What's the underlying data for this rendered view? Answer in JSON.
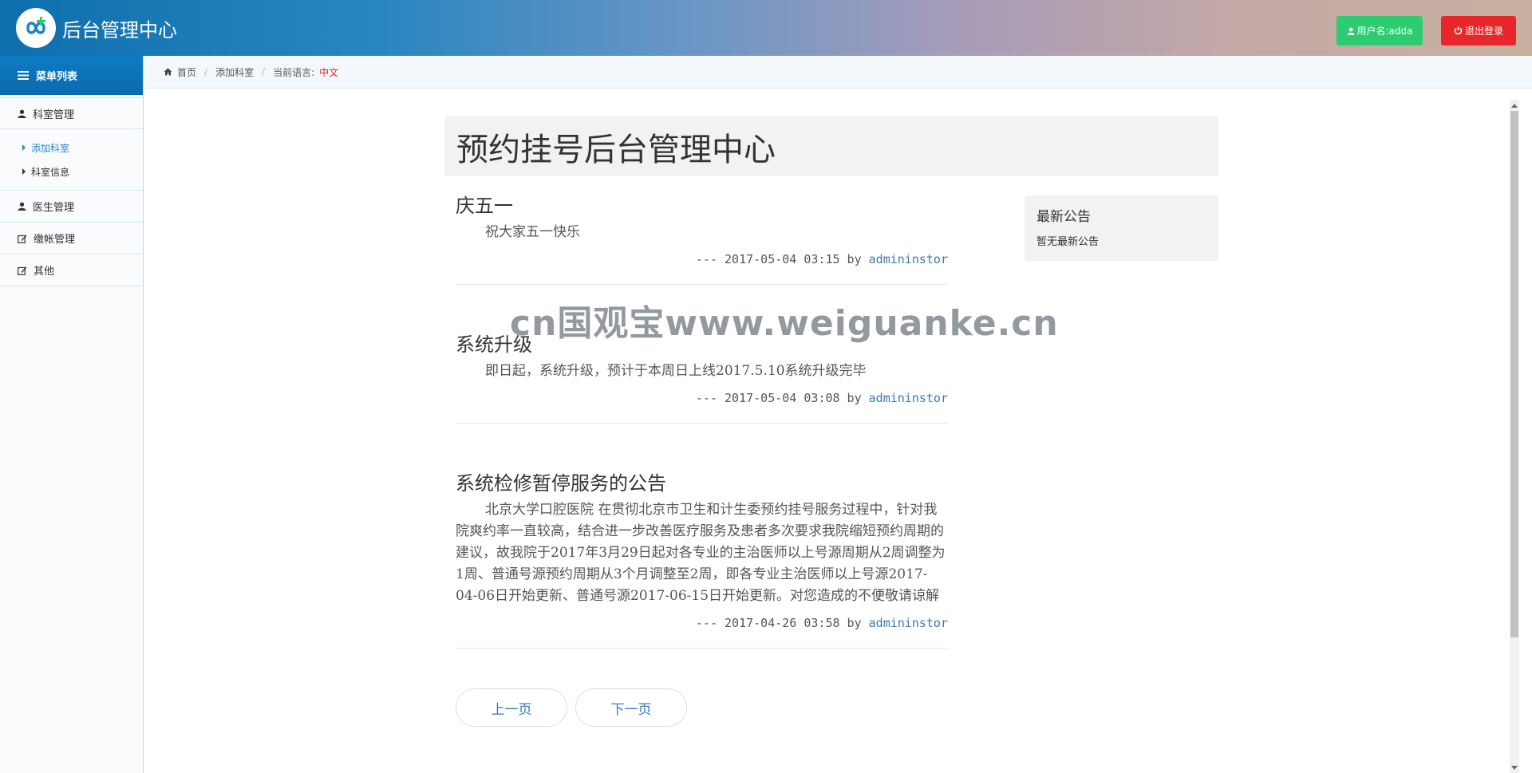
{
  "header": {
    "brand": "后台管理中心",
    "user_label": "用户名:adda",
    "logout_label": "退出登录",
    "accent_colors": {
      "user": "#2ecc71",
      "logout": "#e8272b"
    }
  },
  "sidebar": {
    "menu_title": "菜单列表",
    "groups": [
      {
        "label": "科室管理",
        "icon": "user-icon",
        "items": [
          {
            "label": "添加科室",
            "active": true
          },
          {
            "label": "科室信息",
            "active": false
          }
        ]
      },
      {
        "label": "医生管理",
        "icon": "user-icon"
      },
      {
        "label": "缴帐管理",
        "icon": "edit-icon"
      },
      {
        "label": "其他",
        "icon": "edit-icon"
      }
    ]
  },
  "breadcrumb": {
    "home": "首页",
    "current": "添加科室",
    "lang_label": "当前语言:",
    "lang_value": "中文"
  },
  "main": {
    "title": "预约挂号后台管理中心",
    "posts": [
      {
        "title": "庆五一",
        "body": "祝大家五一快乐",
        "meta_prefix": "--- 2017-05-04 03:15 by ",
        "author": "admininstor"
      },
      {
        "title": "系统升级",
        "body": "即日起，系统升级，预计于本周日上线2017.5.10系统升级完毕",
        "meta_prefix": "--- 2017-05-04 03:08 by ",
        "author": "admininstor"
      },
      {
        "title": "系统检修暂停服务的公告",
        "body": "北京大学口腔医院 在贯彻北京市卫生和计生委预约挂号服务过程中，针对我院爽约率一直较高，结合进一步改善医疗服务及患者多次要求我院缩短预约周期的建议，故我院于2017年3月29日起对各专业的主治医师以上号源周期从2周调整为1周、普通号源预约周期从3个月调整至2周，即各专业主治医师以上号源2017-04-06日开始更新、普通号源2017-06-15日开始更新。对您造成的不便敬请谅解",
        "meta_prefix": "--- 2017-04-26 03:58 by ",
        "author": "admininstor"
      }
    ],
    "pager": {
      "prev": "上一页",
      "next": "下一页"
    }
  },
  "notice": {
    "title": "最新公告",
    "text": "暂无最新公告"
  },
  "watermark": "cn国观宝www.weiguanke.cn"
}
